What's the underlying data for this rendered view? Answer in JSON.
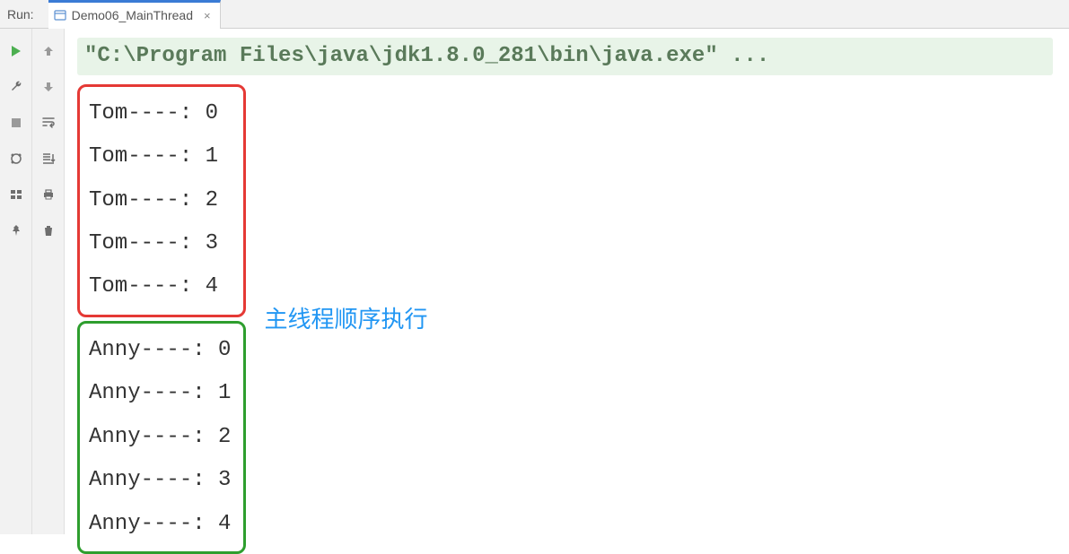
{
  "header": {
    "run_label": "Run:",
    "tab": {
      "label": "Demo06_MainThread",
      "close": "×"
    }
  },
  "console": {
    "command": "\"C:\\Program Files\\java\\jdk1.8.0_281\\bin\\java.exe\" ...",
    "group1": [
      "Tom----: 0",
      "Tom----: 1",
      "Tom----: 2",
      "Tom----: 3",
      "Tom----: 4"
    ],
    "group2": [
      "Anny----: 0",
      "Anny----: 1",
      "Anny----: 2",
      "Anny----: 3",
      "Anny----: 4"
    ],
    "annotation": "主线程顺序执行"
  },
  "colors": {
    "tab_active": "#3a7bd5",
    "box_red": "#e53935",
    "box_green": "#2e9e2e",
    "annotation": "#2196f3",
    "cmd_bg": "#e8f4e8"
  }
}
